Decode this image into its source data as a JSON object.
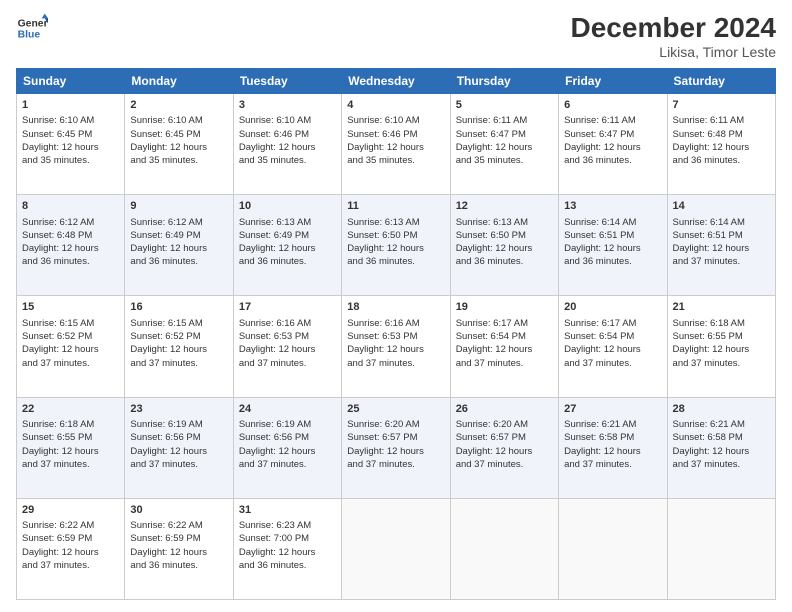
{
  "header": {
    "logo_line1": "General",
    "logo_line2": "Blue",
    "month": "December 2024",
    "location": "Likisa, Timor Leste"
  },
  "days_of_week": [
    "Sunday",
    "Monday",
    "Tuesday",
    "Wednesday",
    "Thursday",
    "Friday",
    "Saturday"
  ],
  "weeks": [
    [
      {
        "day": "1",
        "lines": [
          "Sunrise: 6:10 AM",
          "Sunset: 6:45 PM",
          "Daylight: 12 hours",
          "and 35 minutes."
        ]
      },
      {
        "day": "2",
        "lines": [
          "Sunrise: 6:10 AM",
          "Sunset: 6:45 PM",
          "Daylight: 12 hours",
          "and 35 minutes."
        ]
      },
      {
        "day": "3",
        "lines": [
          "Sunrise: 6:10 AM",
          "Sunset: 6:46 PM",
          "Daylight: 12 hours",
          "and 35 minutes."
        ]
      },
      {
        "day": "4",
        "lines": [
          "Sunrise: 6:10 AM",
          "Sunset: 6:46 PM",
          "Daylight: 12 hours",
          "and 35 minutes."
        ]
      },
      {
        "day": "5",
        "lines": [
          "Sunrise: 6:11 AM",
          "Sunset: 6:47 PM",
          "Daylight: 12 hours",
          "and 35 minutes."
        ]
      },
      {
        "day": "6",
        "lines": [
          "Sunrise: 6:11 AM",
          "Sunset: 6:47 PM",
          "Daylight: 12 hours",
          "and 36 minutes."
        ]
      },
      {
        "day": "7",
        "lines": [
          "Sunrise: 6:11 AM",
          "Sunset: 6:48 PM",
          "Daylight: 12 hours",
          "and 36 minutes."
        ]
      }
    ],
    [
      {
        "day": "8",
        "lines": [
          "Sunrise: 6:12 AM",
          "Sunset: 6:48 PM",
          "Daylight: 12 hours",
          "and 36 minutes."
        ]
      },
      {
        "day": "9",
        "lines": [
          "Sunrise: 6:12 AM",
          "Sunset: 6:49 PM",
          "Daylight: 12 hours",
          "and 36 minutes."
        ]
      },
      {
        "day": "10",
        "lines": [
          "Sunrise: 6:13 AM",
          "Sunset: 6:49 PM",
          "Daylight: 12 hours",
          "and 36 minutes."
        ]
      },
      {
        "day": "11",
        "lines": [
          "Sunrise: 6:13 AM",
          "Sunset: 6:50 PM",
          "Daylight: 12 hours",
          "and 36 minutes."
        ]
      },
      {
        "day": "12",
        "lines": [
          "Sunrise: 6:13 AM",
          "Sunset: 6:50 PM",
          "Daylight: 12 hours",
          "and 36 minutes."
        ]
      },
      {
        "day": "13",
        "lines": [
          "Sunrise: 6:14 AM",
          "Sunset: 6:51 PM",
          "Daylight: 12 hours",
          "and 36 minutes."
        ]
      },
      {
        "day": "14",
        "lines": [
          "Sunrise: 6:14 AM",
          "Sunset: 6:51 PM",
          "Daylight: 12 hours",
          "and 37 minutes."
        ]
      }
    ],
    [
      {
        "day": "15",
        "lines": [
          "Sunrise: 6:15 AM",
          "Sunset: 6:52 PM",
          "Daylight: 12 hours",
          "and 37 minutes."
        ]
      },
      {
        "day": "16",
        "lines": [
          "Sunrise: 6:15 AM",
          "Sunset: 6:52 PM",
          "Daylight: 12 hours",
          "and 37 minutes."
        ]
      },
      {
        "day": "17",
        "lines": [
          "Sunrise: 6:16 AM",
          "Sunset: 6:53 PM",
          "Daylight: 12 hours",
          "and 37 minutes."
        ]
      },
      {
        "day": "18",
        "lines": [
          "Sunrise: 6:16 AM",
          "Sunset: 6:53 PM",
          "Daylight: 12 hours",
          "and 37 minutes."
        ]
      },
      {
        "day": "19",
        "lines": [
          "Sunrise: 6:17 AM",
          "Sunset: 6:54 PM",
          "Daylight: 12 hours",
          "and 37 minutes."
        ]
      },
      {
        "day": "20",
        "lines": [
          "Sunrise: 6:17 AM",
          "Sunset: 6:54 PM",
          "Daylight: 12 hours",
          "and 37 minutes."
        ]
      },
      {
        "day": "21",
        "lines": [
          "Sunrise: 6:18 AM",
          "Sunset: 6:55 PM",
          "Daylight: 12 hours",
          "and 37 minutes."
        ]
      }
    ],
    [
      {
        "day": "22",
        "lines": [
          "Sunrise: 6:18 AM",
          "Sunset: 6:55 PM",
          "Daylight: 12 hours",
          "and 37 minutes."
        ]
      },
      {
        "day": "23",
        "lines": [
          "Sunrise: 6:19 AM",
          "Sunset: 6:56 PM",
          "Daylight: 12 hours",
          "and 37 minutes."
        ]
      },
      {
        "day": "24",
        "lines": [
          "Sunrise: 6:19 AM",
          "Sunset: 6:56 PM",
          "Daylight: 12 hours",
          "and 37 minutes."
        ]
      },
      {
        "day": "25",
        "lines": [
          "Sunrise: 6:20 AM",
          "Sunset: 6:57 PM",
          "Daylight: 12 hours",
          "and 37 minutes."
        ]
      },
      {
        "day": "26",
        "lines": [
          "Sunrise: 6:20 AM",
          "Sunset: 6:57 PM",
          "Daylight: 12 hours",
          "and 37 minutes."
        ]
      },
      {
        "day": "27",
        "lines": [
          "Sunrise: 6:21 AM",
          "Sunset: 6:58 PM",
          "Daylight: 12 hours",
          "and 37 minutes."
        ]
      },
      {
        "day": "28",
        "lines": [
          "Sunrise: 6:21 AM",
          "Sunset: 6:58 PM",
          "Daylight: 12 hours",
          "and 37 minutes."
        ]
      }
    ],
    [
      {
        "day": "29",
        "lines": [
          "Sunrise: 6:22 AM",
          "Sunset: 6:59 PM",
          "Daylight: 12 hours",
          "and 37 minutes."
        ]
      },
      {
        "day": "30",
        "lines": [
          "Sunrise: 6:22 AM",
          "Sunset: 6:59 PM",
          "Daylight: 12 hours",
          "and 36 minutes."
        ]
      },
      {
        "day": "31",
        "lines": [
          "Sunrise: 6:23 AM",
          "Sunset: 7:00 PM",
          "Daylight: 12 hours",
          "and 36 minutes."
        ]
      },
      null,
      null,
      null,
      null
    ]
  ]
}
